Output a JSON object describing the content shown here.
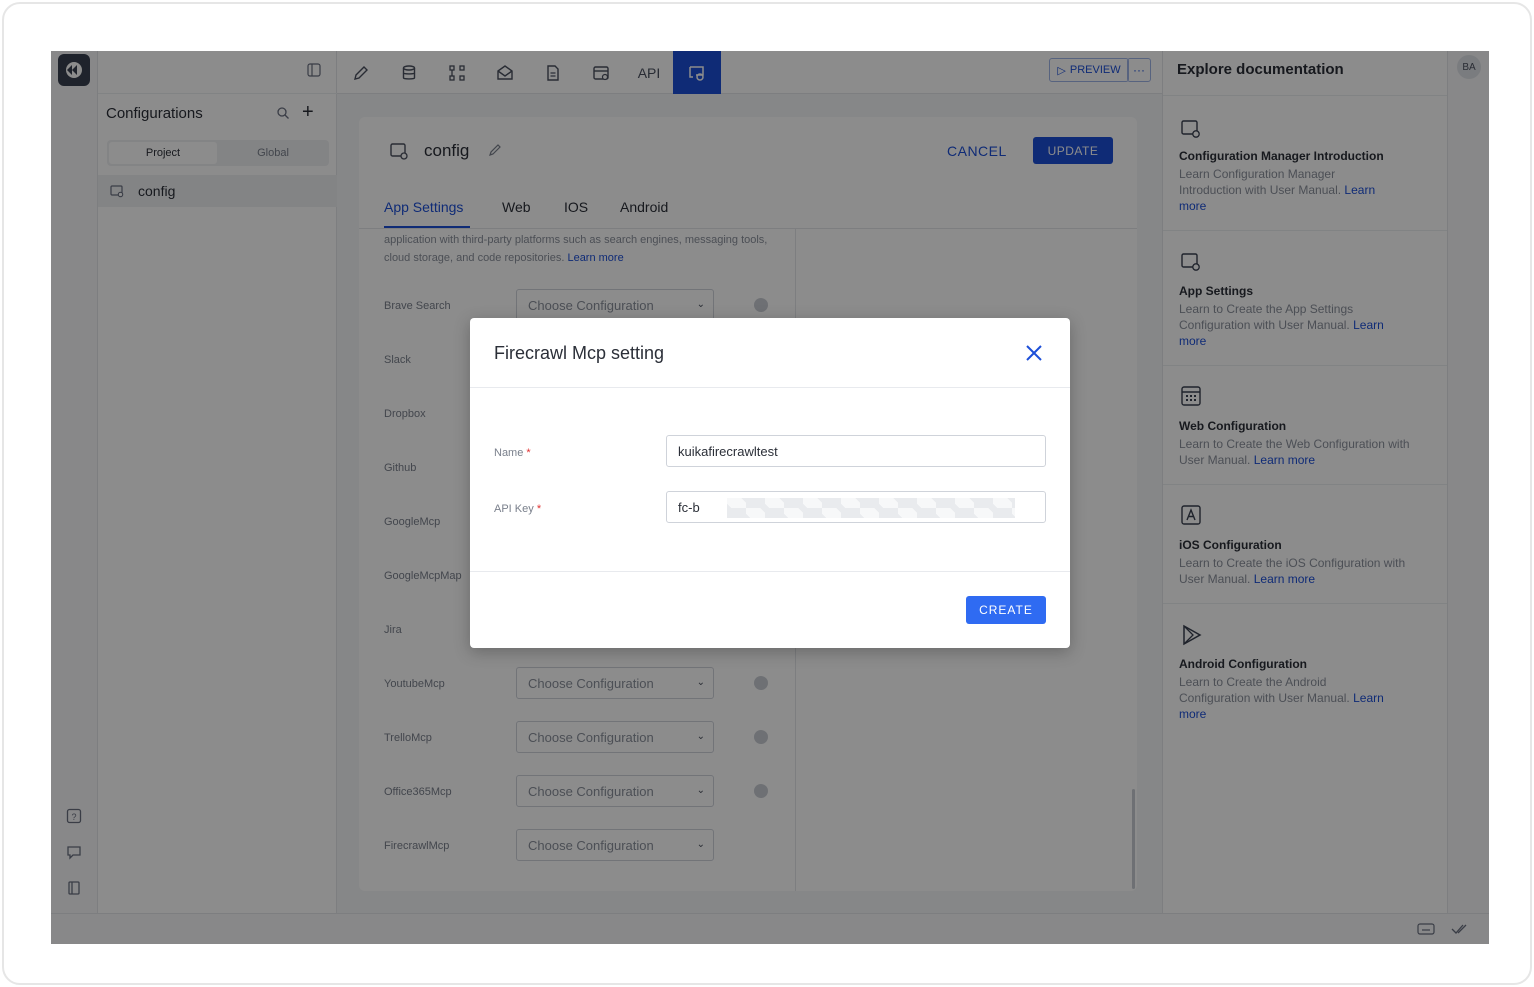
{
  "toolbar": {
    "api_label": "API",
    "preview_label": "PREVIEW",
    "more_label": "···"
  },
  "config_panel": {
    "title": "Configurations",
    "segments": [
      "Project",
      "Global"
    ],
    "items": [
      {
        "label": "config"
      }
    ]
  },
  "main": {
    "title": "config",
    "cancel_label": "CANCEL",
    "update_label": "UPDATE",
    "tabs": [
      "App Settings",
      "Web",
      "IOS",
      "Android"
    ],
    "description": "application with third-party platforms such as search engines, messaging tools, cloud storage, and code repositories.",
    "description_link": "Learn more",
    "select_placeholder": "Choose Configuration",
    "rows": [
      {
        "label": "Brave Search"
      },
      {
        "label": "Slack"
      },
      {
        "label": "Dropbox"
      },
      {
        "label": "Github"
      },
      {
        "label": "GoogleMcp"
      },
      {
        "label": "GoogleMcpMap"
      },
      {
        "label": "Jira"
      },
      {
        "label": "YoutubeMcp"
      },
      {
        "label": "TrelloMcp"
      },
      {
        "label": "Office365Mcp"
      },
      {
        "label": "FirecrawlMcp"
      }
    ]
  },
  "docs": {
    "title": "Explore documentation",
    "link_label": "Learn more",
    "cards": [
      {
        "title": "Configuration Manager Introduction",
        "desc": "Learn Configuration Manager Introduction with User Manual.",
        "icon": "config-icon"
      },
      {
        "title": "App Settings",
        "desc": "Learn to Create the App Settings Configuration with User Manual.",
        "icon": "config-icon"
      },
      {
        "title": "Web Configuration",
        "desc": "Learn to Create the Web Configuration with User Manual.",
        "icon": "calendar-grid-icon"
      },
      {
        "title": "iOS Configuration",
        "desc": "Learn to Create the iOS Configuration with User Manual.",
        "icon": "app-store-icon"
      },
      {
        "title": "Android Configuration",
        "desc": "Learn to Create the Android Configuration with User Manual.",
        "icon": "play-store-icon"
      }
    ]
  },
  "user": {
    "initials": "BA"
  },
  "modal": {
    "title": "Firecrawl Mcp setting",
    "name_label": "Name",
    "name_value": "kuikafirecrawltest",
    "api_key_label": "API Key",
    "api_key_value": "fc-b",
    "required_mark": "*",
    "create_label": "CREATE"
  },
  "colors": {
    "accent": "#1d4fd8",
    "button_blue": "#2f6bf2",
    "required": "#e03131"
  }
}
